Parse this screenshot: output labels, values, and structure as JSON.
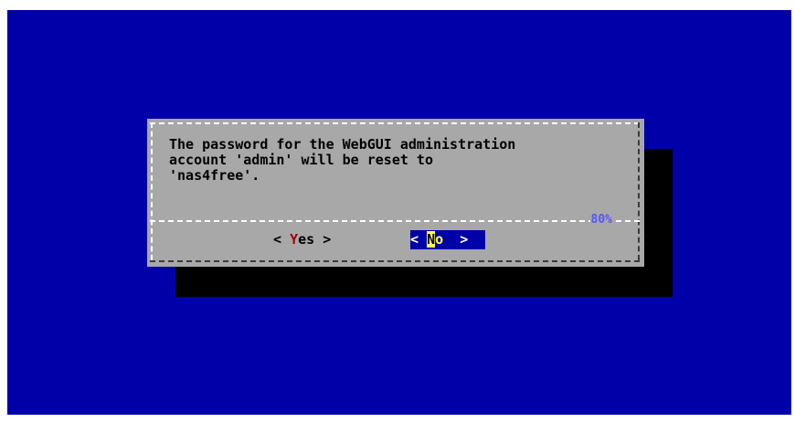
{
  "dialog": {
    "message_lines": [
      "The password for the WebGUI administration",
      "account 'admin' will be reset to",
      "'nas4free'."
    ],
    "progress": "80%"
  },
  "buttons": {
    "yes": {
      "left": "<",
      "hotkey": "Y",
      "rest": "es",
      "right": ">"
    },
    "no": {
      "left": "<",
      "hotkey": "N",
      "rest": "o",
      "right": ">"
    }
  },
  "colors": {
    "background": "#0000a8",
    "dialog": "#a8a8a8",
    "shadow": "#000000",
    "hotkey_yes": "#a80000",
    "selected_button_bg": "#0000a8",
    "selected_text": "#fcfc54",
    "progress_text": "#5454fc"
  }
}
